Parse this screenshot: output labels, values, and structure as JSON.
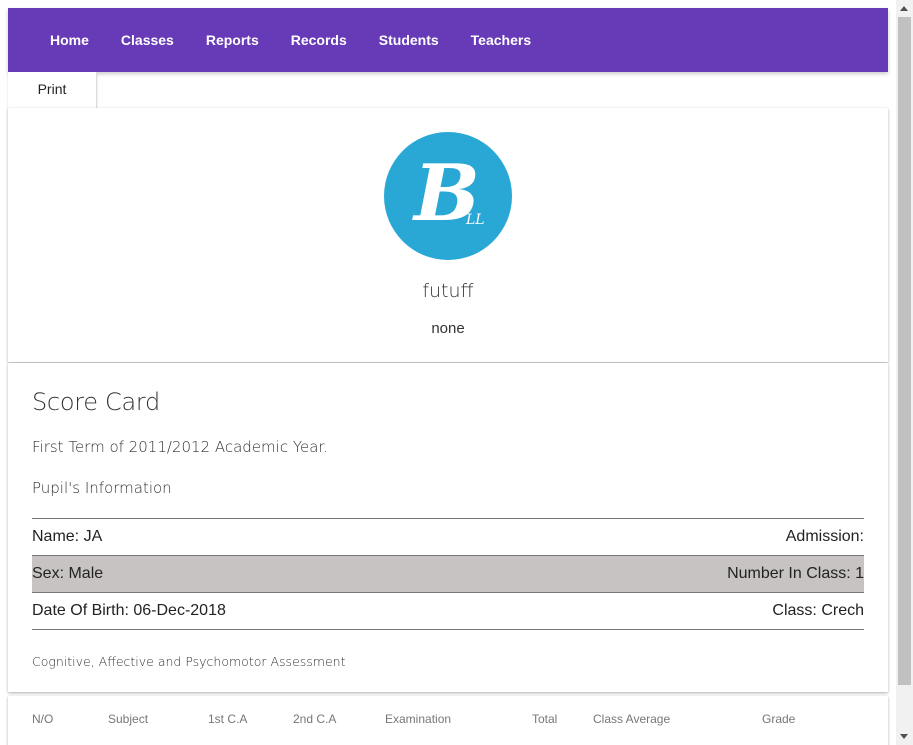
{
  "nav": {
    "items": [
      {
        "label": "Home"
      },
      {
        "label": "Classes"
      },
      {
        "label": "Reports"
      },
      {
        "label": "Records"
      },
      {
        "label": "Students"
      },
      {
        "label": "Teachers"
      }
    ]
  },
  "toolbar": {
    "print_label": "Print"
  },
  "profile": {
    "logo_icon": "school-logo-icon",
    "name": "futuff",
    "subtitle": "none"
  },
  "score_card": {
    "title": "Score Card",
    "term": "First Term of 2011/2012 Academic Year.",
    "section": "Pupil's Information",
    "rows": [
      {
        "left": "Name: JA",
        "right": "Admission:"
      },
      {
        "left": "Sex: Male",
        "right": "Number In Class: 1"
      },
      {
        "left": "Date Of Birth: 06-Dec-2018",
        "right": "Class: Crech"
      }
    ],
    "assessment": "Cognitive, Affective and Psychomotor Assessment"
  },
  "results_table": {
    "headers": [
      "N/O",
      "Subject",
      "1st C.A",
      "2nd C.A",
      "Examination",
      "Total",
      "Class Average",
      "Grade"
    ]
  },
  "colors": {
    "navbar": "#673ab7",
    "logo": "#29a8d6",
    "shaded_row": "#c8c3c3"
  }
}
